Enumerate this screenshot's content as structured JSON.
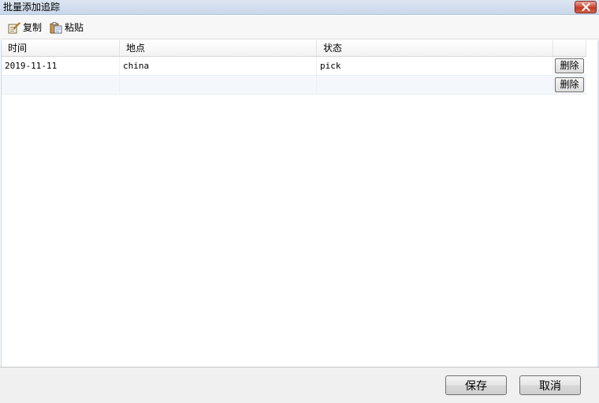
{
  "window": {
    "title": "批量添加追踪"
  },
  "toolbar": {
    "copy_label": "复制",
    "paste_label": "粘贴"
  },
  "grid": {
    "columns": [
      "时间",
      "地点",
      "状态"
    ],
    "rows": [
      {
        "time": "2019-11-11",
        "place": "china",
        "status": "pick",
        "delete_label": "删除"
      },
      {
        "time": "",
        "place": "",
        "status": "",
        "delete_label": "删除"
      }
    ]
  },
  "footer": {
    "save_label": "保存",
    "cancel_label": "取消"
  },
  "colors": {
    "titlebar": "#c9d8ea",
    "close_button": "#c23a24",
    "alt_row": "#f4f8fc"
  }
}
